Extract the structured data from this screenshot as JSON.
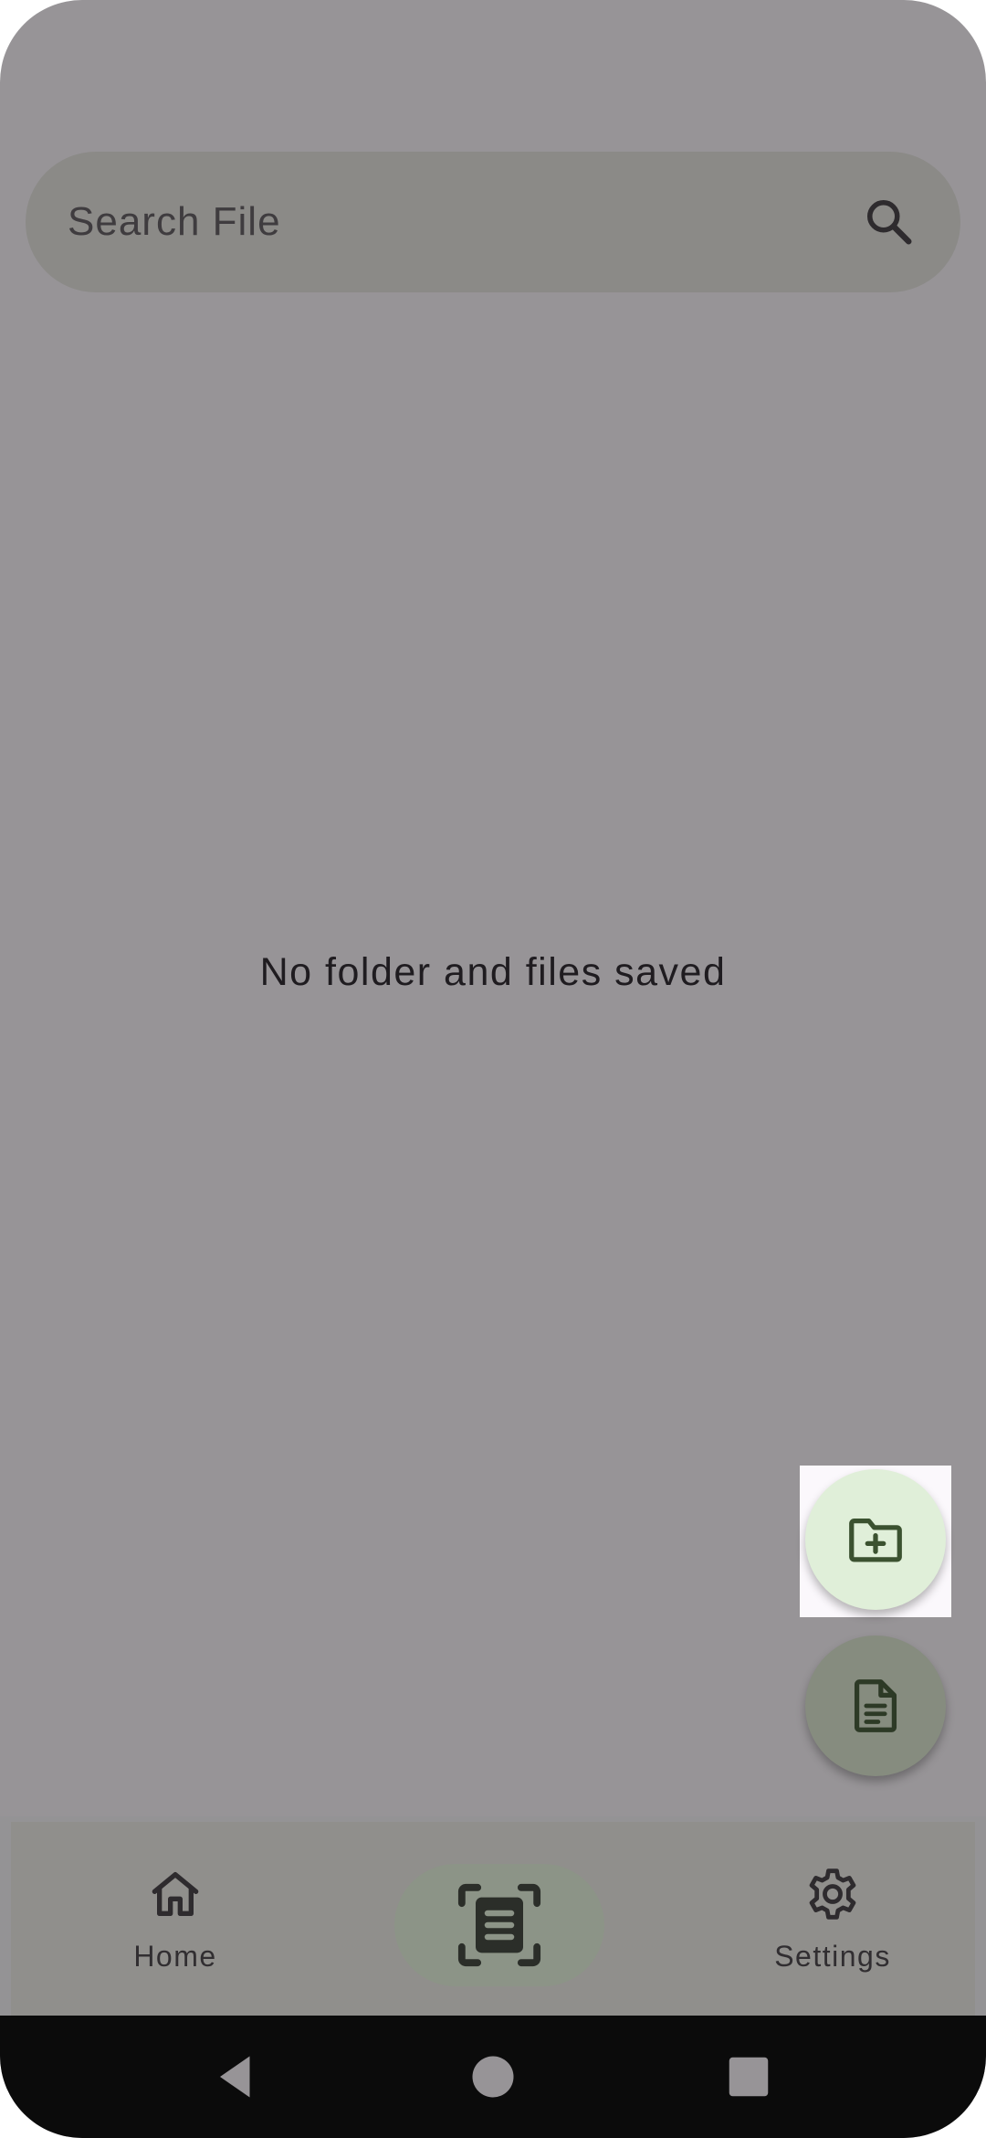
{
  "search": {
    "placeholder": "Search File",
    "icon": "search-icon"
  },
  "main": {
    "empty_message": "No folder and files saved"
  },
  "fabs": {
    "new_folder_icon": "folder-plus-icon",
    "new_file_icon": "document-icon"
  },
  "bottom_nav": {
    "home_label": "Home",
    "scan_icon": "scan-document-icon",
    "settings_label": "Settings"
  },
  "system_nav": {
    "back_icon": "back-icon",
    "home_icon": "home-circle-icon",
    "recents_icon": "recents-icon"
  },
  "colors": {
    "scrim": "#979497",
    "search_bg": "#8b8a87",
    "fab_primary": "#e0efd9",
    "fab_secondary": "#868c7f",
    "icon_green": "#3b5230",
    "nav_bg": "#908f8c",
    "system_nav_bg": "#0b0b0b"
  }
}
